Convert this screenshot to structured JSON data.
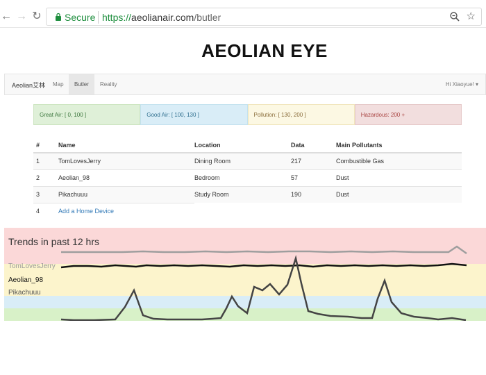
{
  "browser": {
    "secure_label": "Secure",
    "url_scheme": "https://",
    "url_host": "aeolianair.com",
    "url_path": "/butler"
  },
  "page": {
    "title": "AEOLIAN EYE"
  },
  "navbar": {
    "brand": "Aeolian艾林",
    "items": [
      {
        "label": "Map",
        "active": false
      },
      {
        "label": "Butler",
        "active": true
      },
      {
        "label": "Reality",
        "active": false
      }
    ],
    "user_greeting": "Hi Xiaoyue!"
  },
  "legend": [
    {
      "label": "Great Air: [ 0, 100 ]",
      "color": "#dff0d8"
    },
    {
      "label": "Good Air: [ 100, 130 ]",
      "color": "#d9edf7"
    },
    {
      "label": "Pollution: [ 130, 200 ]",
      "color": "#fcf8e3"
    },
    {
      "label": "Hazardous: 200 +",
      "color": "#f2dede"
    }
  ],
  "table": {
    "headers": [
      "#",
      "Name",
      "Location",
      "Data",
      "Main Pollutants"
    ],
    "rows": [
      {
        "num": "1",
        "name": "TomLovesJerry",
        "location": "Dining Room",
        "data": "217",
        "pollutant": "Combustible Gas"
      },
      {
        "num": "2",
        "name": "Aeolian_98",
        "location": "Bedroom",
        "data": "57",
        "pollutant": "Dust"
      },
      {
        "num": "3",
        "name": "Pikachuuu",
        "location": "Study Room",
        "data": "190",
        "pollutant": "Dust"
      }
    ],
    "add_row": {
      "num": "4",
      "label": "Add a Home Device"
    }
  },
  "trends": {
    "title": "Trends in past 12 hrs",
    "series": [
      {
        "name": "TomLovesJerry",
        "color": "#9e9e9e"
      },
      {
        "name": "Aeolian_98",
        "color": "#111111"
      },
      {
        "name": "Pikachuuu",
        "color": "#444444"
      }
    ]
  }
}
